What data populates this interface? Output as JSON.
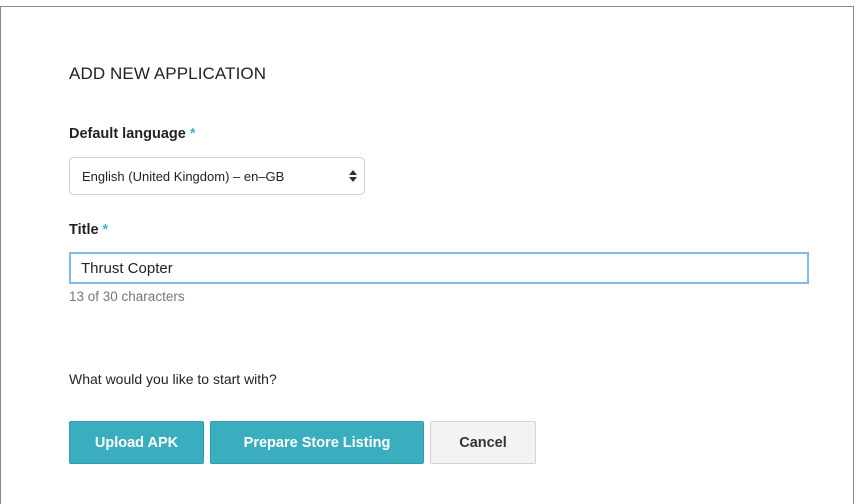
{
  "dialog": {
    "title": "ADD NEW APPLICATION"
  },
  "language": {
    "label": "Default language",
    "required_marker": "*",
    "selected": "English (United Kingdom) – en–GB"
  },
  "title_field": {
    "label": "Title",
    "required_marker": "*",
    "value": "Thrust Copter",
    "char_count": "13 of 30 characters"
  },
  "start": {
    "prompt": "What would you like to start with?"
  },
  "buttons": {
    "upload_apk": "Upload APK",
    "prepare_store_listing": "Prepare Store Listing",
    "cancel": "Cancel"
  },
  "colors": {
    "accent": "#3aaebe",
    "required": "#45b6c6",
    "input_focus_border": "#7fb9e6"
  },
  "icons": {
    "select_arrows": "up-down-arrows-icon"
  }
}
